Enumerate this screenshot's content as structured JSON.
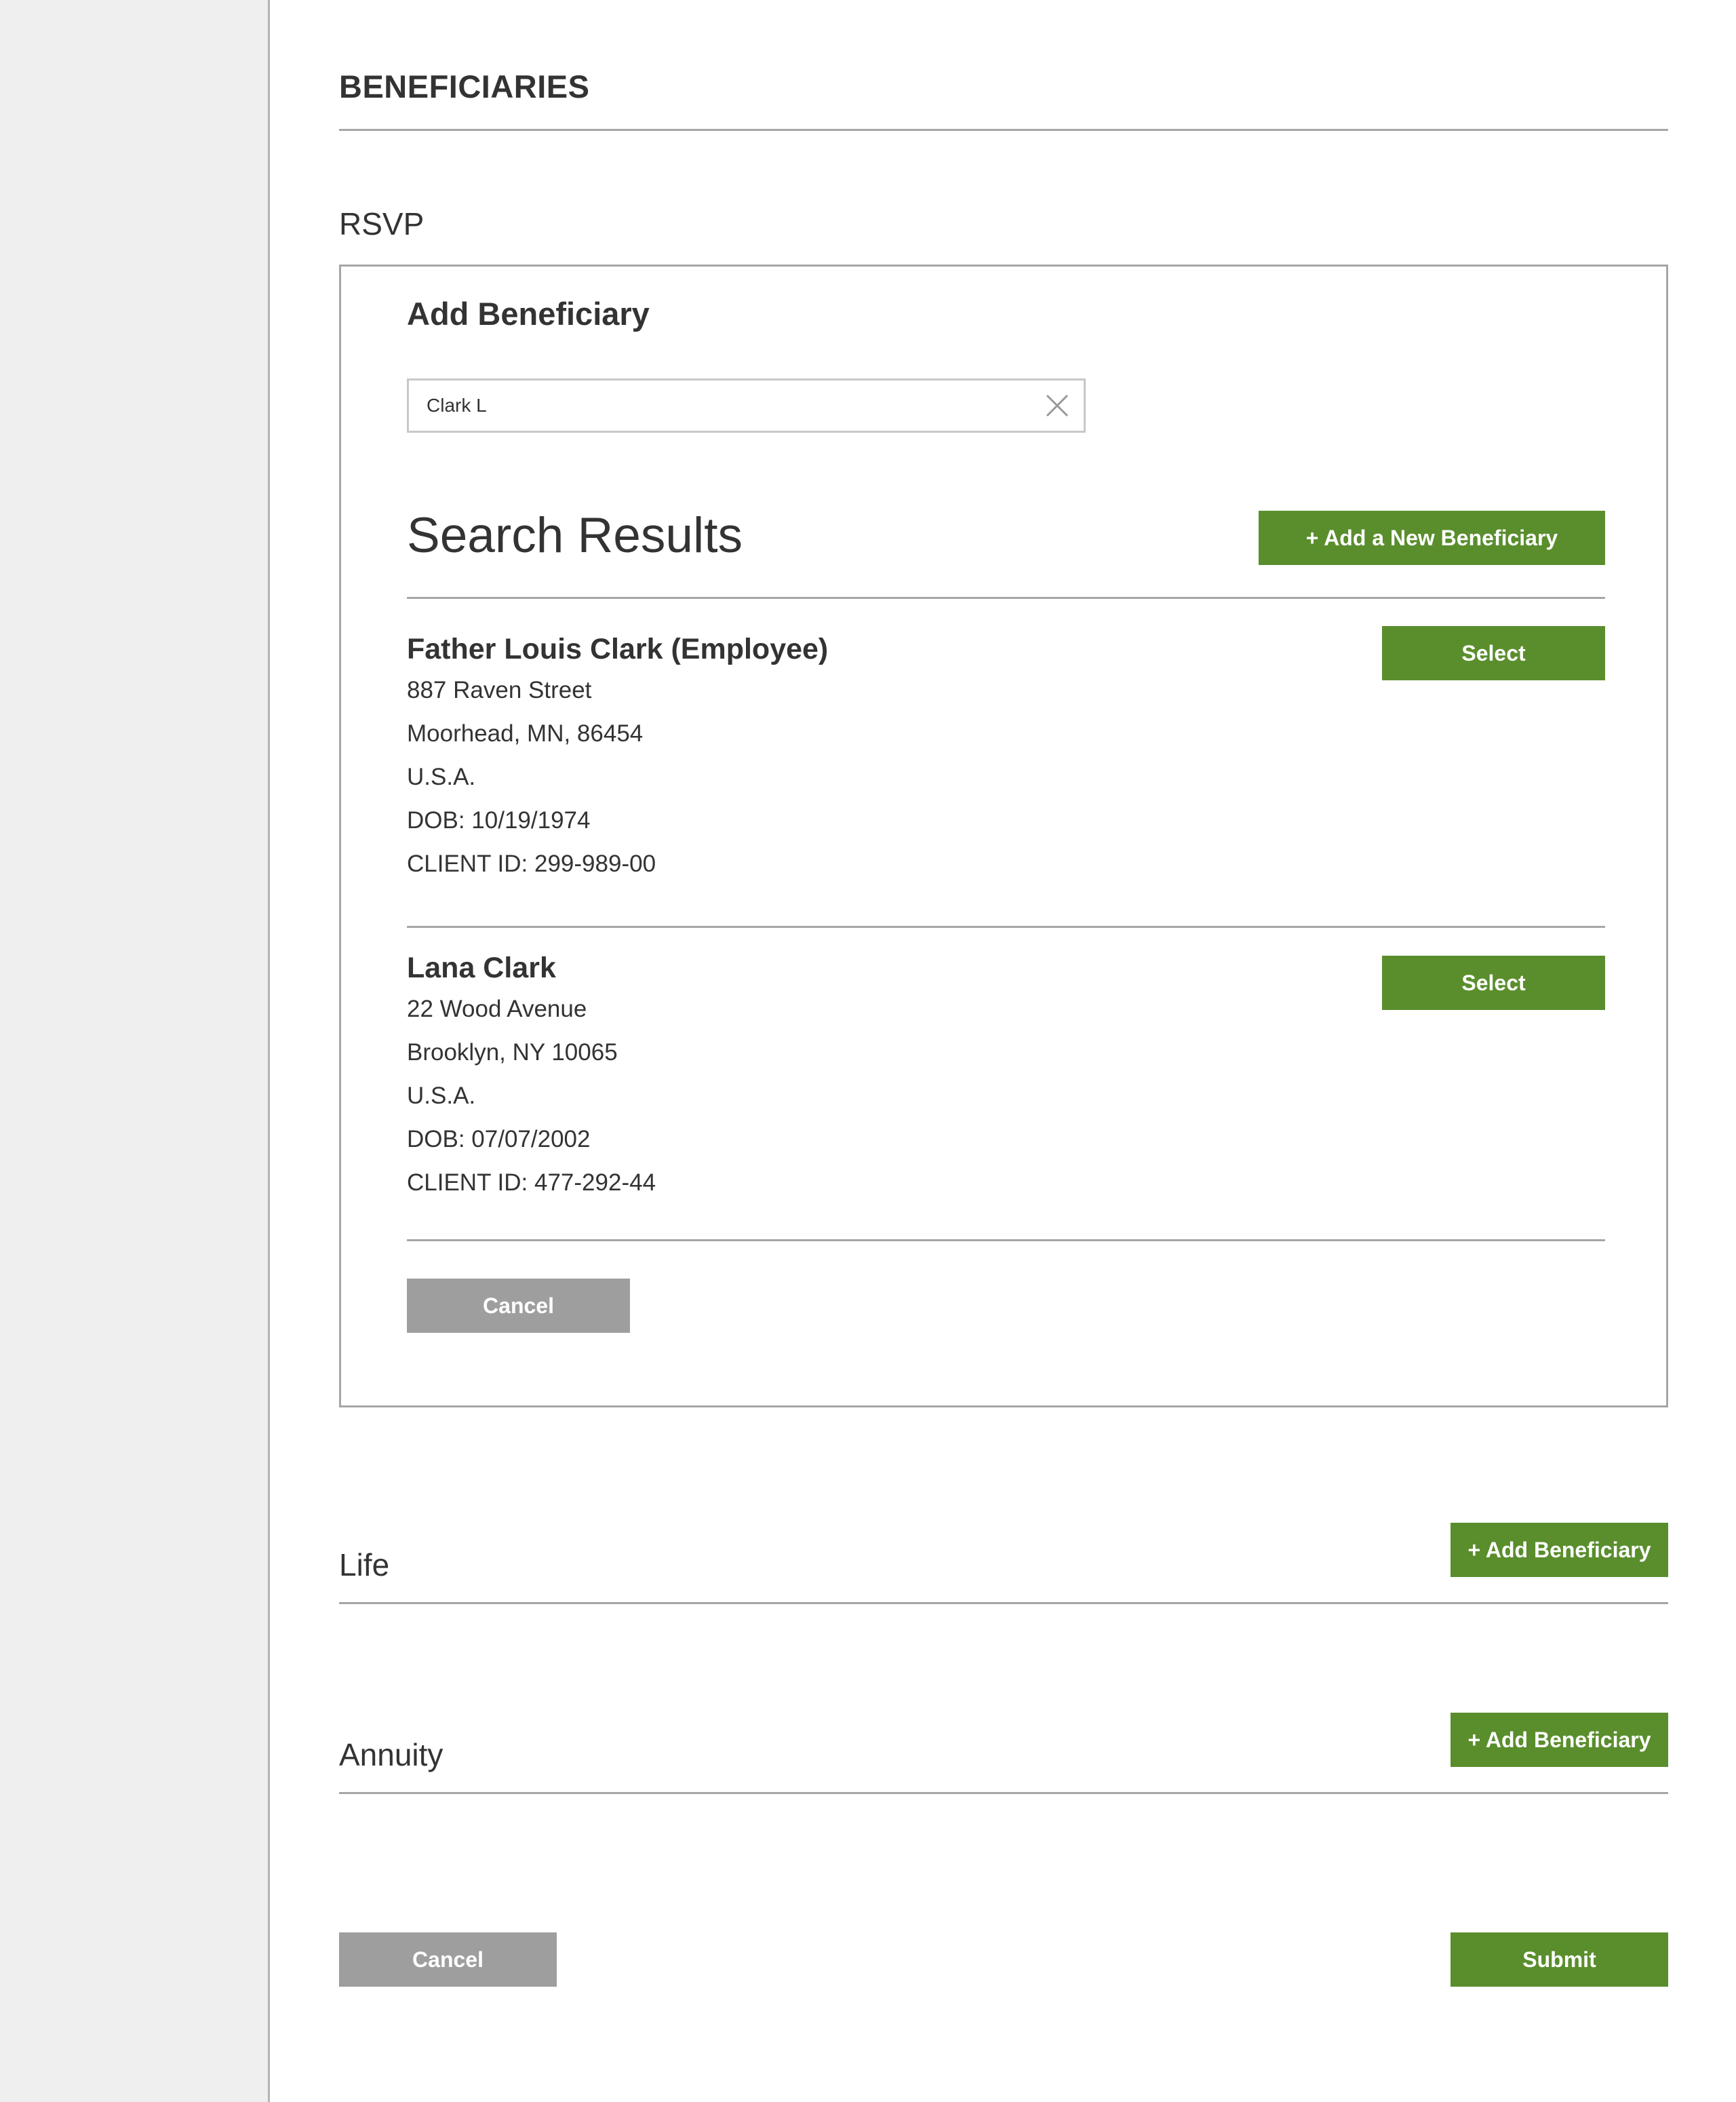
{
  "page": {
    "title": "BENEFICIARIES"
  },
  "rsvp": {
    "label": "RSVP",
    "panel": {
      "heading": "Add Beneficiary",
      "search": {
        "value": "Clark L"
      },
      "results_heading": "Search Results",
      "add_new_label": "+ Add a New Beneficiary",
      "results": [
        {
          "name": "Father Louis Clark (Employee)",
          "address1": "887 Raven Street",
          "address2": "Moorhead, MN, 86454",
          "country": "U.S.A.",
          "dob": "DOB: 10/19/1974",
          "client_id": "CLIENT ID: 299-989-00",
          "select_label": "Select"
        },
        {
          "name": "Lana Clark",
          "address1": "22 Wood Avenue",
          "address2": "Brooklyn, NY 10065",
          "country": "U.S.A.",
          "dob": "DOB: 07/07/2002",
          "client_id": "CLIENT ID: 477-292-44",
          "select_label": "Select"
        }
      ],
      "cancel_label": "Cancel"
    }
  },
  "life": {
    "label": "Life",
    "add_label": "+ Add Beneficiary"
  },
  "annuity": {
    "label": "Annuity",
    "add_label": "+ Add Beneficiary"
  },
  "footer": {
    "cancel_label": "Cancel",
    "submit_label": "Submit"
  },
  "colors": {
    "accent_green": "#5a8e2d",
    "button_gray": "#9e9e9e",
    "sidebar_bg": "#efefef",
    "text": "#333333"
  },
  "icons": {
    "search_clear": "close-icon"
  }
}
